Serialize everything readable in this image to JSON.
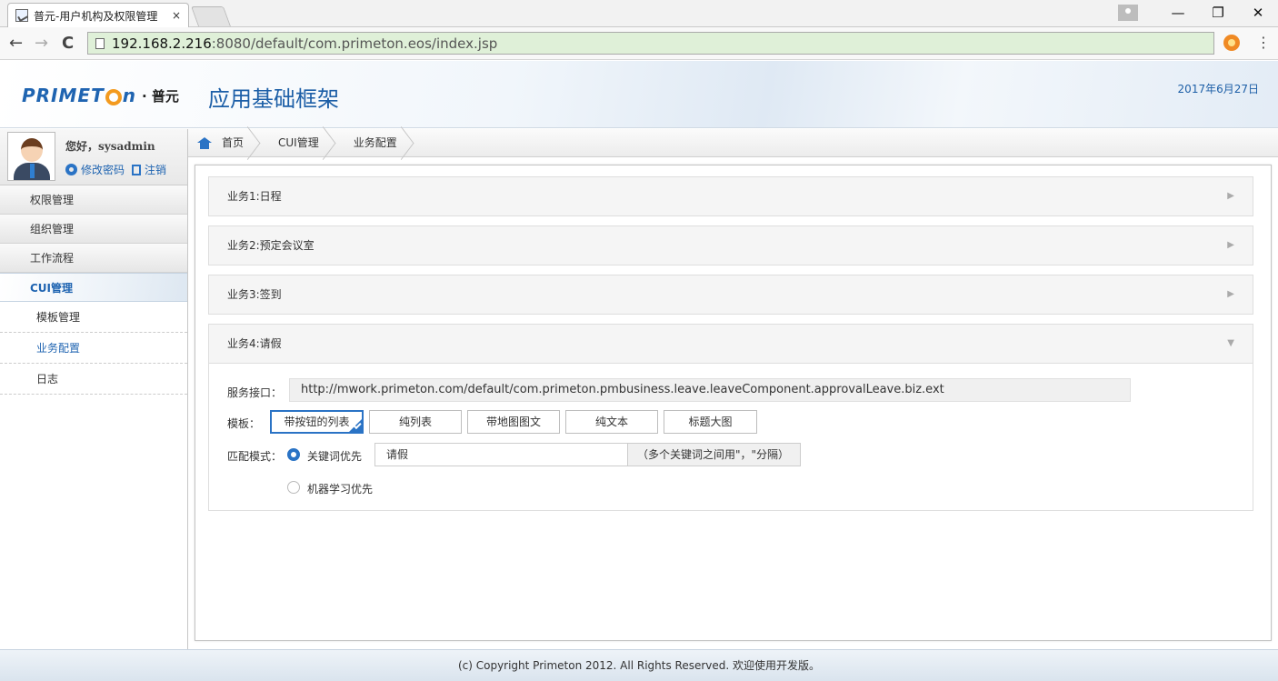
{
  "browser": {
    "tab_title": "普元-用户机构及权限管理",
    "tab_close": "×",
    "url_host": "192.168.2.216",
    "url_rest": ":8080/default/com.primeton.eos/index.jsp",
    "back": "←",
    "forward": "→",
    "reload": "C",
    "menu": "⋮",
    "minimize": "—",
    "restore": "❐",
    "close": "✕"
  },
  "header": {
    "logo_part1": "PRIMET",
    "logo_part2": "n",
    "logo_cn": "· 普元",
    "title": "应用基础框架",
    "date": "2017年6月27日"
  },
  "user": {
    "greeting": "您好，sysadmin",
    "change_password": "修改密码",
    "logout": "注销"
  },
  "sidebar": {
    "menu": [
      "权限管理",
      "组织管理",
      "工作流程"
    ],
    "active_menu": "CUI管理",
    "sub_items": [
      "模板管理",
      "业务配置",
      "日志"
    ]
  },
  "breadcrumb": [
    "首页",
    "CUI管理",
    "业务配置"
  ],
  "accordion": [
    {
      "title": "业务1:日程",
      "arrow": "▶"
    },
    {
      "title": "业务2:预定会议室",
      "arrow": "▶"
    },
    {
      "title": "业务3:签到",
      "arrow": "▶"
    },
    {
      "title": "业务4:请假",
      "arrow": "▼"
    }
  ],
  "detail": {
    "service_label": "服务接口：",
    "service_url": "http://mwork.primeton.com/default/com.primeton.pmbusiness.leave.leaveComponent.approvalLeave.biz.ext",
    "template_label": "模板：",
    "templates": [
      "带按钮的列表",
      "纯列表",
      "带地图图文",
      "纯文本",
      "标题大图"
    ],
    "match_label": "匹配模式：",
    "match_keyword": "关键词优先",
    "match_ml": "机器学习优先",
    "keyword_value": "请假",
    "keyword_hint": "（多个关键词之间用\"，\"分隔）"
  },
  "footer": {
    "text": "(c) Copyright Primeton 2012. All Rights Reserved. 欢迎使用开发版。"
  },
  "colors": {
    "accent": "#2a73c5",
    "brand_blue": "#1d5fa7",
    "logo_orange": "#f39a1e",
    "omnibox_green": "#dff0d8"
  }
}
